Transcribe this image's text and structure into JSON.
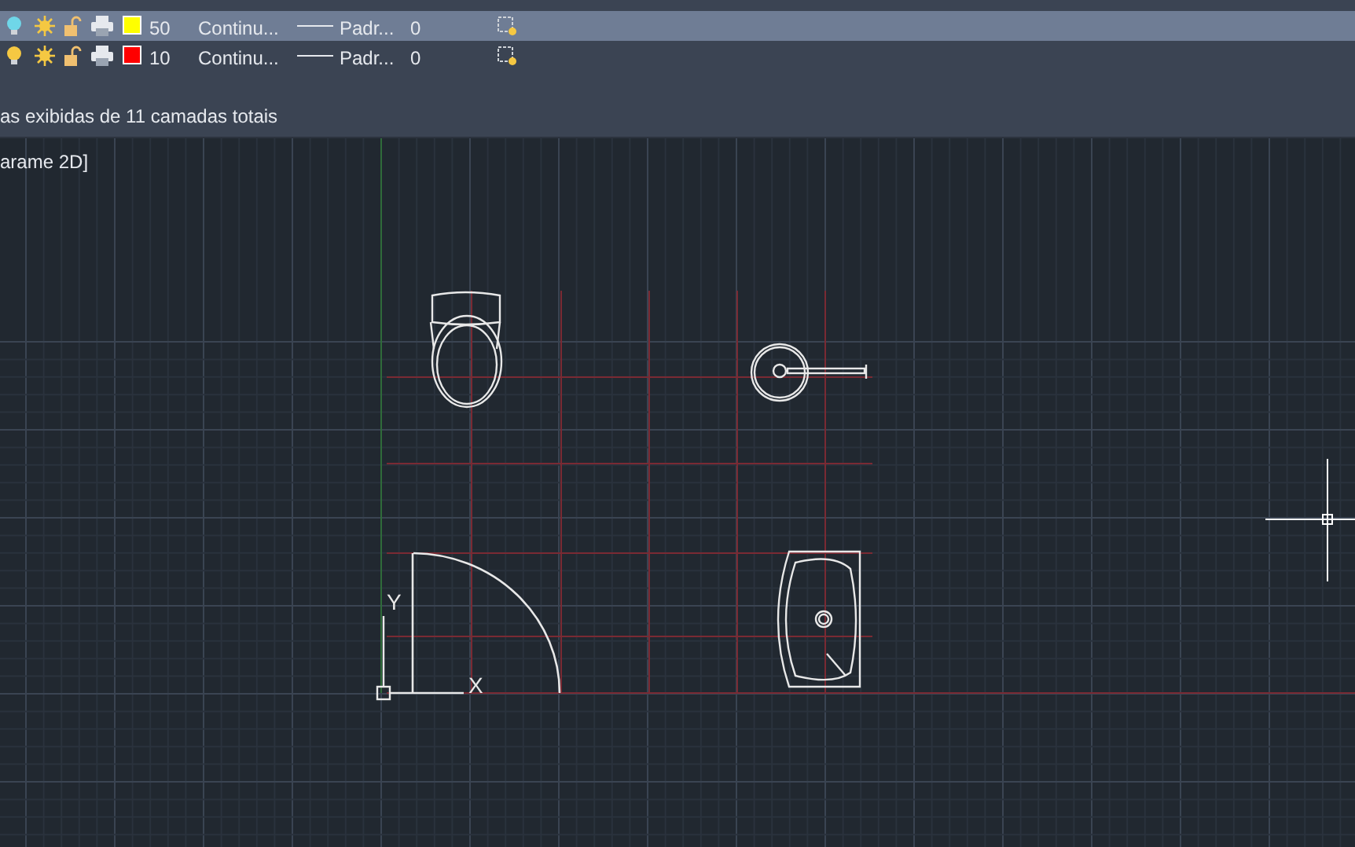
{
  "layers": {
    "rows": [
      {
        "selected": true,
        "color": "#ffff00",
        "name": "50",
        "linetype": "Continu...",
        "lineweight": "Padr...",
        "transparency": "0"
      },
      {
        "selected": false,
        "color": "#ff0000",
        "name": "10",
        "linetype": "Continu...",
        "lineweight": "Padr...",
        "transparency": "0"
      }
    ],
    "status": "as exibidas de 11 camadas totais"
  },
  "viewport": {
    "label": "arame 2D]",
    "ucs": {
      "x_label": "X",
      "y_label": "Y"
    }
  }
}
